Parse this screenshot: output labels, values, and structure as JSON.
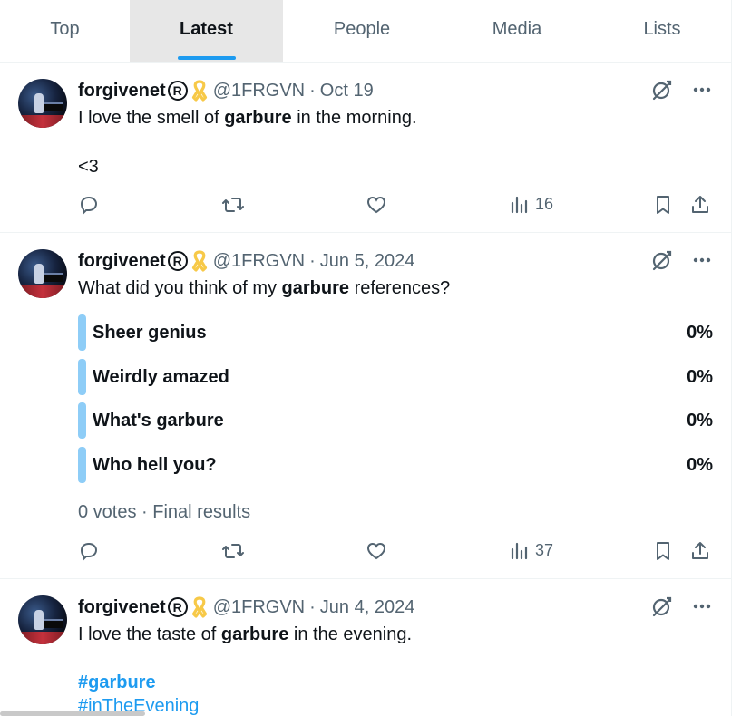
{
  "tabs": [
    {
      "label": "Top",
      "active": false
    },
    {
      "label": "Latest",
      "active": true
    },
    {
      "label": "People",
      "active": false
    },
    {
      "label": "Media",
      "active": false
    },
    {
      "label": "Lists",
      "active": false
    }
  ],
  "posts": [
    {
      "name": "forgivenet",
      "reg_mark": "R",
      "handle": "@1FRGVN",
      "separator": "·",
      "date": "Oct 19",
      "text": {
        "before": "I love the smell of ",
        "bold": "garbure",
        "after": " in the morning.",
        "line2": "<3"
      },
      "views": "16"
    },
    {
      "name": "forgivenet",
      "reg_mark": "R",
      "handle": "@1FRGVN",
      "separator": "·",
      "date": "Jun 5, 2024",
      "text": {
        "before": "What did you think of my ",
        "bold": "garbure",
        "after": " references?"
      },
      "poll": {
        "options": [
          {
            "label": "Sheer genius",
            "pct": "0%"
          },
          {
            "label": "Weirdly amazed",
            "pct": "0%"
          },
          {
            "label": "What's garbure",
            "pct": "0%"
          },
          {
            "label": "Who hell you?",
            "pct": "0%"
          }
        ],
        "meta": "0 votes · Final results"
      },
      "views": "37"
    },
    {
      "name": "forgivenet",
      "reg_mark": "R",
      "handle": "@1FRGVN",
      "separator": "·",
      "date": "Jun 4, 2024",
      "text": {
        "before": "I love the taste of ",
        "bold": "garbure",
        "after": " in the evening."
      },
      "hashtags": [
        "#garbure",
        "#inTheEvening"
      ]
    }
  ],
  "colors": {
    "accent": "#1d9bf0",
    "muted": "#536471",
    "poll_bar": "#8ecdf7",
    "ribbon": "#f7c948"
  }
}
